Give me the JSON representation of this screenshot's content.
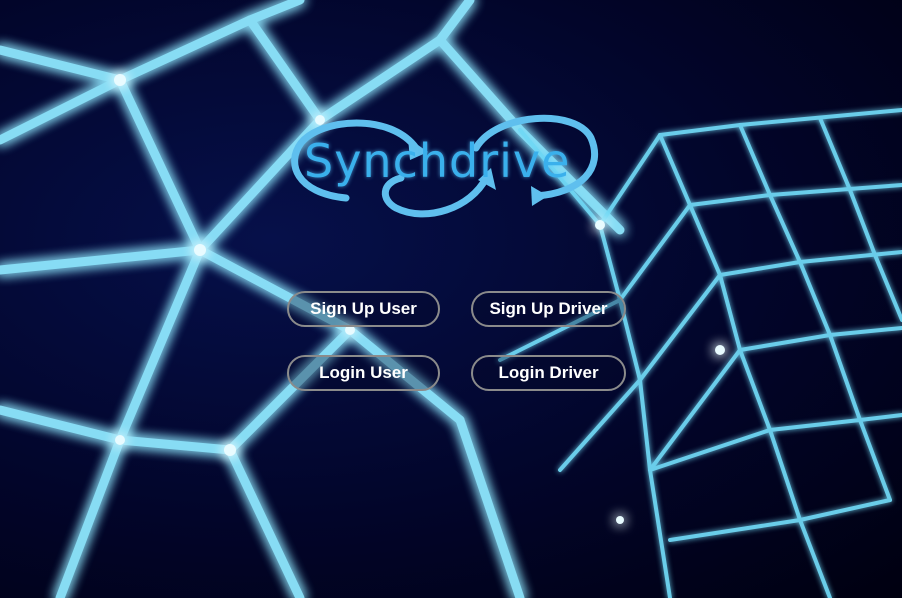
{
  "app": {
    "logo_text": "Synchdrive",
    "accent_color": "#3ab0ec",
    "background_theme": "neon-grid-cubes"
  },
  "buttons": {
    "signup_user": "Sign Up User",
    "signup_driver": "Sign Up Driver",
    "login_user": "Login User",
    "login_driver": "Login Driver"
  }
}
